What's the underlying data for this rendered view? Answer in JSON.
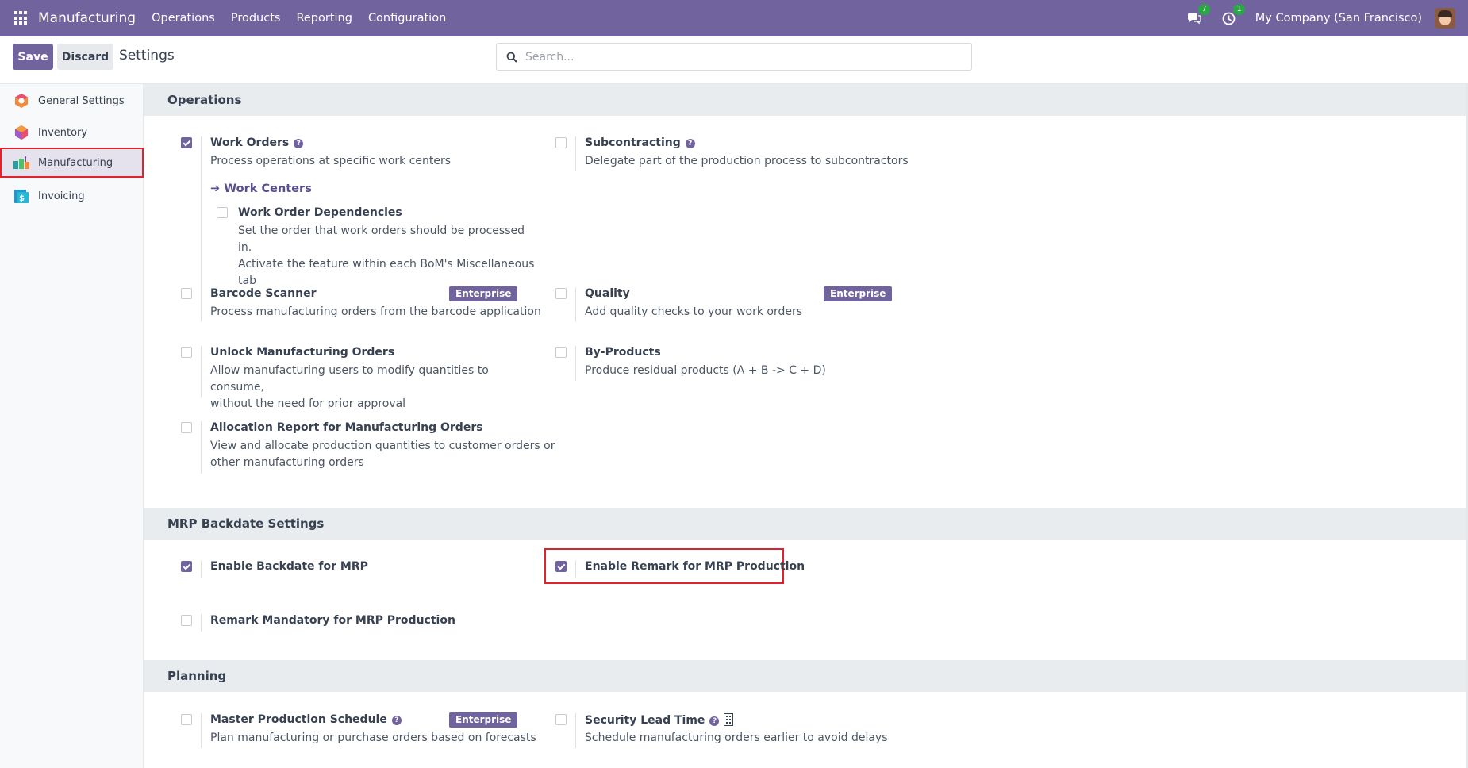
{
  "navbar": {
    "app_title": "Manufacturing",
    "menus": [
      "Operations",
      "Products",
      "Reporting",
      "Configuration"
    ],
    "messages_count": "7",
    "activities_count": "1",
    "company": "My Company (San Francisco)",
    "color": "#71639e"
  },
  "control": {
    "save_label": "Save",
    "discard_label": "Discard",
    "breadcrumb": "Settings",
    "search_placeholder": "Search..."
  },
  "sidebar": {
    "items": [
      {
        "label": "General Settings",
        "icon": "general-settings-icon"
      },
      {
        "label": "Inventory",
        "icon": "inventory-icon"
      },
      {
        "label": "Manufacturing",
        "icon": "manufacturing-icon",
        "active": true
      },
      {
        "label": "Invoicing",
        "icon": "invoicing-icon"
      }
    ]
  },
  "sections": {
    "operations": {
      "title": "Operations",
      "work_orders": {
        "title": "Work Orders",
        "desc": "Process operations at specific work centers",
        "checked": true
      },
      "work_centers_link": "Work Centers",
      "work_order_dependencies": {
        "title": "Work Order Dependencies",
        "desc_lines": [
          "Set the order that work orders should be processed in.",
          "Activate the feature within each BoM's Miscellaneous",
          "tab"
        ],
        "checked": false
      },
      "subcontracting": {
        "title": "Subcontracting",
        "desc": "Delegate part of the production process to subcontractors",
        "checked": false
      },
      "barcode_scanner": {
        "title": "Barcode Scanner",
        "desc": "Process manufacturing orders from the barcode application",
        "badge": "Enterprise",
        "checked": false
      },
      "quality": {
        "title": "Quality",
        "desc": "Add quality checks to your work orders",
        "badge": "Enterprise",
        "checked": false
      },
      "unlock_mo": {
        "title": "Unlock Manufacturing Orders",
        "desc_lines": [
          "Allow manufacturing users to modify quantities to consume,",
          "without the need for prior approval"
        ],
        "checked": false
      },
      "by_products": {
        "title": "By-Products",
        "desc": "Produce residual products (A + B -> C + D)",
        "checked": false
      },
      "allocation_report": {
        "title": "Allocation Report for Manufacturing Orders",
        "desc_lines": [
          "View and allocate production quantities to customer orders or",
          "other manufacturing orders"
        ],
        "checked": false
      }
    },
    "mrp_backdate": {
      "title": "MRP Backdate Settings",
      "enable_backdate": {
        "title": "Enable Backdate for MRP",
        "checked": true
      },
      "enable_remark": {
        "title": "Enable Remark for MRP Production",
        "checked": true
      },
      "remark_mandatory": {
        "title": "Remark Mandatory for MRP Production",
        "checked": false
      }
    },
    "planning": {
      "title": "Planning",
      "mps": {
        "title": "Master Production Schedule",
        "desc": "Plan manufacturing or purchase orders based on forecasts",
        "badge": "Enterprise",
        "checked": false
      },
      "security_lead_time": {
        "title": "Security Lead Time",
        "desc": "Schedule manufacturing orders earlier to avoid delays",
        "checked": false
      }
    }
  }
}
